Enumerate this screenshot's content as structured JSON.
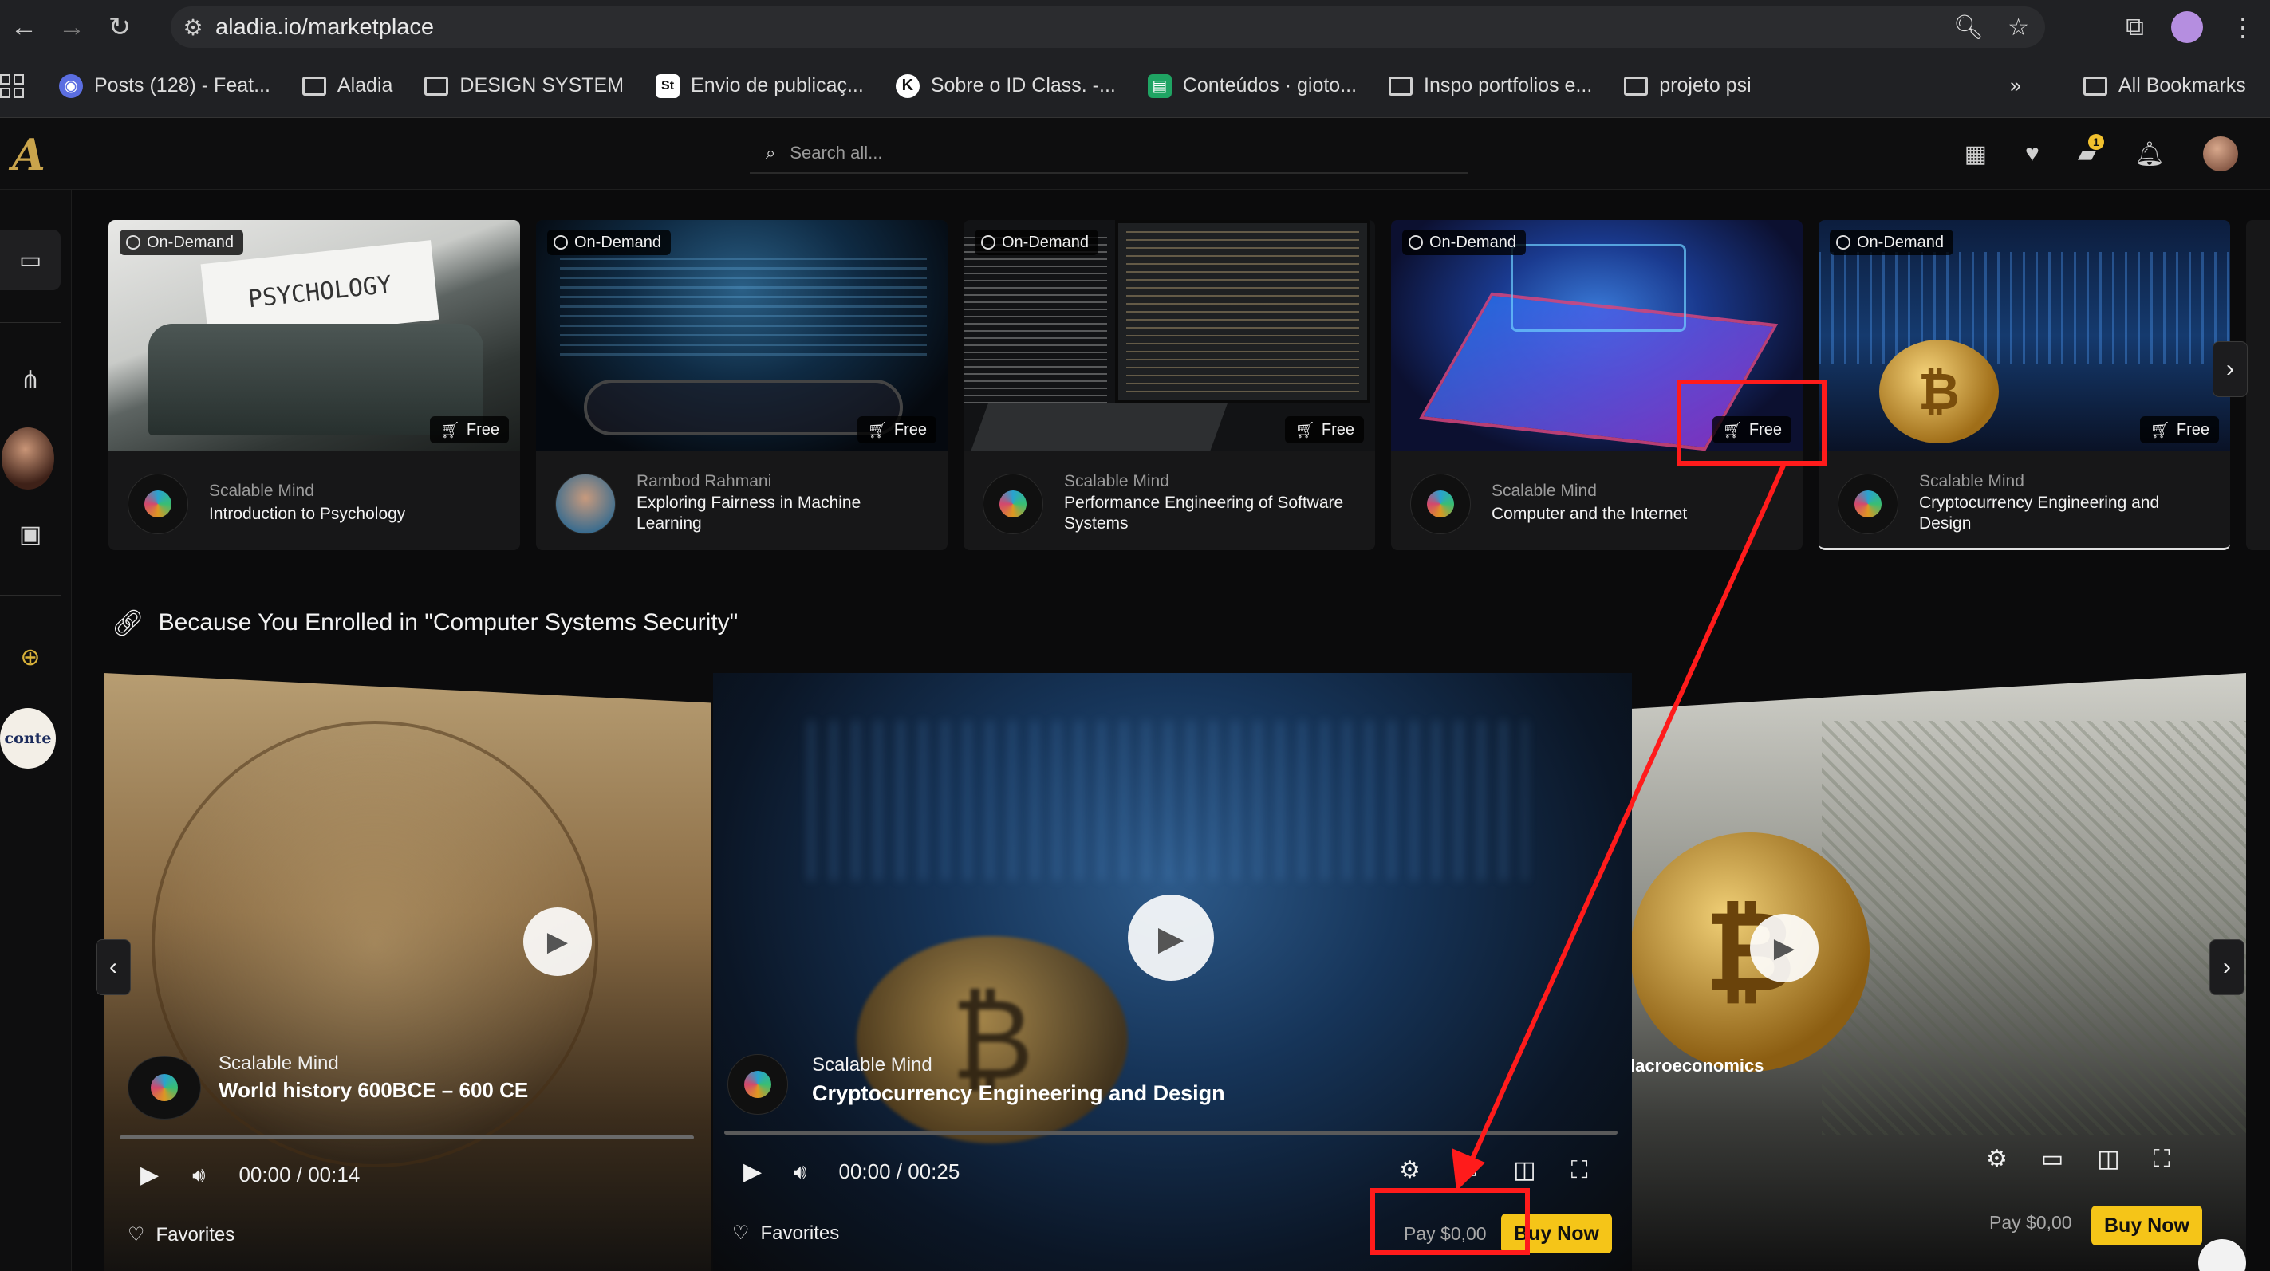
{
  "browser": {
    "url": "aladia.io/marketplace",
    "bookmarks": [
      {
        "label": "Posts (128) - Feat...",
        "icon": "posts-favicon",
        "color": "#5b6ee1"
      },
      {
        "label": "Aladia",
        "icon": "folder-icon"
      },
      {
        "label": "DESIGN SYSTEM",
        "icon": "folder-icon"
      },
      {
        "label": "Envio de publicaç...",
        "icon": "stocksy-favicon"
      },
      {
        "label": "Sobre o ID Class. -...",
        "icon": "k-favicon"
      },
      {
        "label": "Conteúdos · gioto...",
        "icon": "green-doc-favicon"
      },
      {
        "label": "Inspo portfolios e...",
        "icon": "folder-icon"
      },
      {
        "label": "projeto psi",
        "icon": "folder-icon"
      }
    ],
    "more_bookmarks": "»",
    "all_bookmarks": "All Bookmarks"
  },
  "header": {
    "logo_text": "A",
    "search_placeholder": "Search all...",
    "notification_count": "1"
  },
  "sidebar": {
    "conte_label": "conte"
  },
  "cards": [
    {
      "badge": "On-Demand",
      "price": "Free",
      "author": "Scalable Mind",
      "title": "Introduction to Psychology",
      "image": "typewriter-psychology",
      "img_text": "PSYCHOLOGY"
    },
    {
      "badge": "On-Demand",
      "price": "Free",
      "author": "Rambod Rahmani",
      "title": "Exploring Fairness in Machine Learning",
      "image": "code-screen-glasses"
    },
    {
      "badge": "On-Demand",
      "price": "Free",
      "author": "Scalable Mind",
      "title": "Performance Engineering of Software Systems",
      "image": "terminal-monitors"
    },
    {
      "badge": "On-Demand",
      "price": "Free",
      "author": "Scalable Mind",
      "title": "Computer and the Internet",
      "image": "isometric-laptop"
    },
    {
      "badge": "On-Demand",
      "price": "Free",
      "author": "Scalable Mind",
      "title": "Cryptocurrency Engineering and Design",
      "image": "bitcoin-chart"
    }
  ],
  "section": {
    "title": "Because You Enrolled in \"Computer Systems Security\""
  },
  "carousel": {
    "left": {
      "author": "Scalable Mind",
      "title": "World history 600BCE – 600 CE",
      "time": "00:00",
      "duration": "00:14",
      "favorites": "Favorites"
    },
    "center": {
      "author": "Scalable Mind",
      "title": "Cryptocurrency Engineering and Design",
      "time": "00:00",
      "duration": "00:25",
      "favorites": "Favorites",
      "pay": "Pay $0,00",
      "buy": "Buy Now"
    },
    "right": {
      "title": "lacroeconomics",
      "pay": "Pay $0,00",
      "buy": "Buy Now"
    }
  },
  "annotation": {
    "color": "#ff1b1b"
  }
}
